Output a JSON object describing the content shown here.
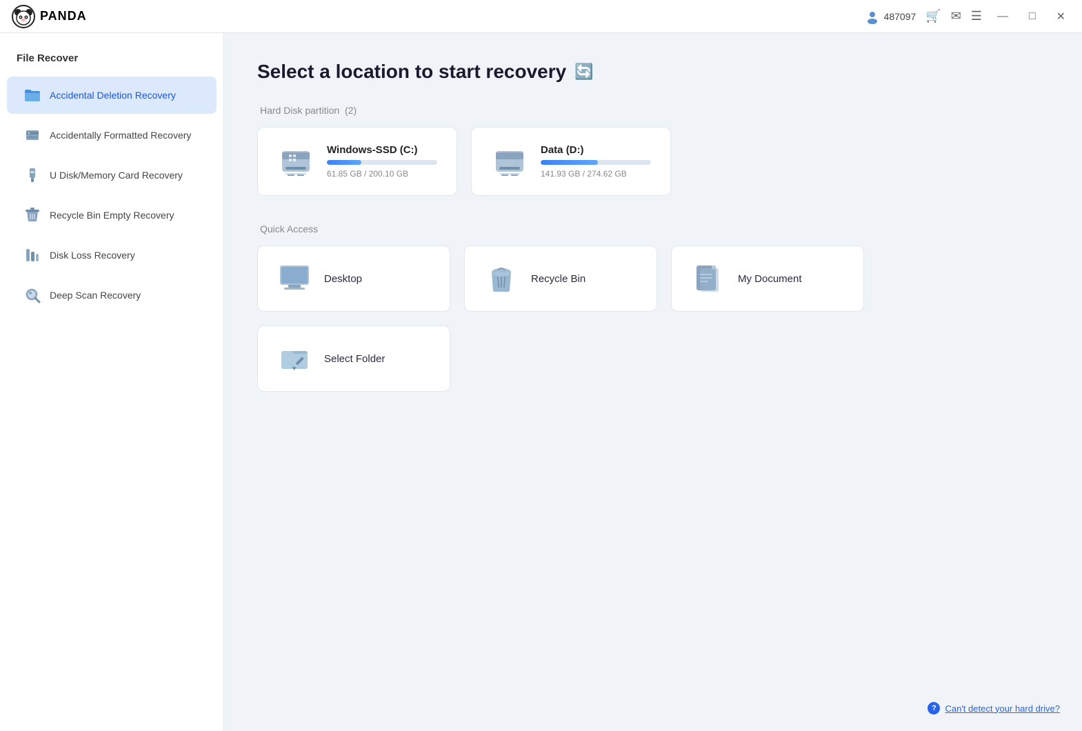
{
  "titlebar": {
    "logo_text": "PANDA",
    "user_id": "487097",
    "minimize_label": "—",
    "maximize_label": "□",
    "close_label": "✕"
  },
  "sidebar": {
    "section_title": "File Recover",
    "items": [
      {
        "id": "accidental-deletion",
        "label": "Accidental Deletion Recovery",
        "active": true
      },
      {
        "id": "accidentally-formatted",
        "label": "Accidentally Formatted Recovery",
        "active": false
      },
      {
        "id": "u-disk",
        "label": "U Disk/Memory Card Recovery",
        "active": false
      },
      {
        "id": "recycle-bin-empty",
        "label": "Recycle Bin Empty Recovery",
        "active": false
      },
      {
        "id": "disk-loss",
        "label": "Disk Loss Recovery",
        "active": false
      },
      {
        "id": "deep-scan",
        "label": "Deep Scan Recovery",
        "active": false
      }
    ]
  },
  "content": {
    "page_title": "Select a location to start recovery",
    "hard_disk_section": "Hard Disk partition",
    "hard_disk_count": "(2)",
    "disks": [
      {
        "name": "Windows-SSD",
        "drive": "(C:)",
        "used_gb": "61.85",
        "total_gb": "200.10",
        "size_label": "61.85 GB / 200.10 GB",
        "progress_pct": 31
      },
      {
        "name": "Data",
        "drive": "(D:)",
        "used_gb": "141.93",
        "total_gb": "274.62",
        "size_label": "141.93 GB / 274.62 GB",
        "progress_pct": 52
      }
    ],
    "quick_access_section": "Quick Access",
    "quick_items": [
      {
        "id": "desktop",
        "label": "Desktop"
      },
      {
        "id": "recycle-bin",
        "label": "Recycle Bin"
      },
      {
        "id": "my-document",
        "label": "My Document"
      },
      {
        "id": "select-folder",
        "label": "Select Folder"
      }
    ],
    "help_link": "Can't detect your hard drive?"
  }
}
